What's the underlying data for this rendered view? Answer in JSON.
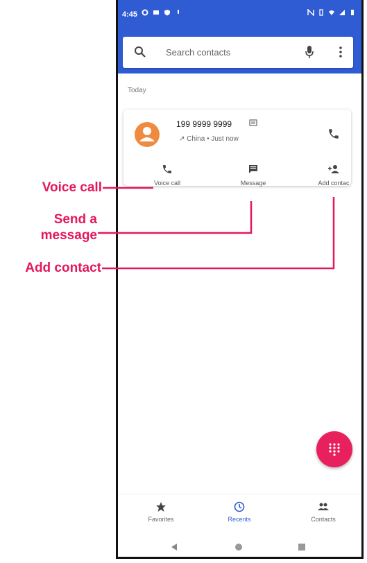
{
  "status_bar": {
    "time": "4:45"
  },
  "search": {
    "placeholder": "Search contacts"
  },
  "recents": {
    "section_label": "Today",
    "entry": {
      "number": "199 9999 9999",
      "detail": "China • Just now",
      "avatar_color": "#f08a3e"
    },
    "actions": [
      {
        "label": "Voice call",
        "icon": "phone-icon"
      },
      {
        "label": "Message",
        "icon": "message-icon"
      },
      {
        "label": "Add contac",
        "icon": "add-contact-icon"
      }
    ]
  },
  "bottom_nav": [
    {
      "label": "Favorites",
      "icon": "star-icon"
    },
    {
      "label": "Recents",
      "icon": "clock-icon",
      "active": true
    },
    {
      "label": "Contacts",
      "icon": "people-icon"
    }
  ],
  "callouts": {
    "voice_call": "Voice call",
    "send_message": "Send a\nmessage",
    "add_contact": "Add contact"
  },
  "colors": {
    "primary": "#2f5bd3",
    "fab": "#e8205e",
    "callout": "#e3185d"
  }
}
